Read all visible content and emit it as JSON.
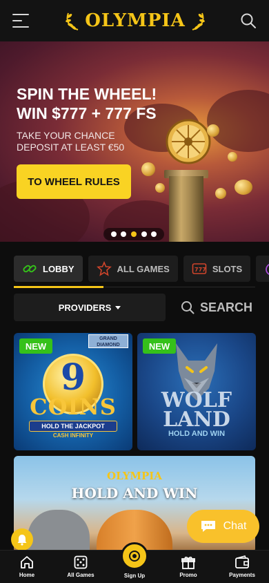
{
  "header": {
    "logo_text": "OLYMPIA",
    "menu_icon": "menu-icon",
    "search_icon": "search-icon"
  },
  "hero": {
    "title": "SPIN THE WHEEL!\nWIN $777 + 777 FS",
    "subtitle": "TAKE YOUR CHANCE\nDEPOSIT AT LEAST €50",
    "button_label": "TO WHEEL RULES",
    "slides_total": 5,
    "active_slide": 3
  },
  "tabs": [
    {
      "label": "LOBBY",
      "icon": "lobby-icon",
      "active": true
    },
    {
      "label": "ALL GAMES",
      "icon": "all-games-icon",
      "active": false
    },
    {
      "label": "SLOTS",
      "icon": "slots-icon",
      "active": false
    },
    {
      "label": "",
      "icon": "halloween-icon",
      "active": false
    }
  ],
  "filters": {
    "providers_label": "PROVIDERS",
    "search_label": "SEARCH"
  },
  "games": [
    {
      "badge": "NEW",
      "corner_label": "GRAND\nDIAMOND",
      "title_number": "9",
      "title_word": "COINS",
      "tag_line": "HOLD THE JACKPOT",
      "sub_line": "CASH INFINITY"
    },
    {
      "badge": "NEW",
      "title_word": "WOLF\nLAND",
      "tag_line": "HOLD AND WIN"
    },
    {
      "logo_text": "OLYMPIA",
      "title": "HOLD AND WIN"
    }
  ],
  "chat": {
    "label": "Chat"
  },
  "bottom_nav": [
    {
      "label": "Home",
      "icon": "home-icon"
    },
    {
      "label": "All Games",
      "icon": "dice-icon"
    },
    {
      "label": "Sign Up",
      "icon": "laurel-icon"
    },
    {
      "label": "Promo",
      "icon": "gift-icon"
    },
    {
      "label": "Payments",
      "icon": "wallet-icon"
    }
  ],
  "colors": {
    "accent": "#f5c518",
    "button": "#f9d323",
    "badge_new": "#35c11a",
    "background": "#0d0d0d"
  }
}
